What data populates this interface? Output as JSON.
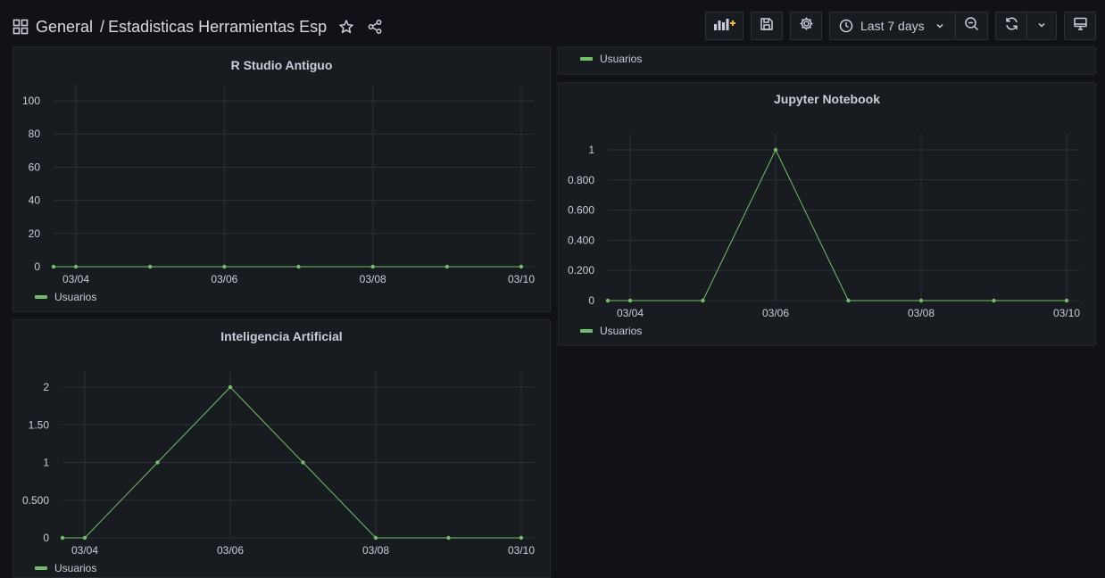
{
  "header": {
    "folder": "General",
    "separator": "/",
    "dashboard_title": "Estadisticas Herramientas Esp",
    "time_range": "Last 7 days"
  },
  "colors": {
    "series": "#73bf69",
    "background": "#111217",
    "panel": "#181b1f",
    "grid": "#2c3038",
    "accent": "#f5b73b"
  },
  "icons": [
    "apps-icon",
    "star-icon",
    "share-icon",
    "add-panel-icon",
    "save-icon",
    "gear-icon",
    "clock-icon",
    "chevron-down-icon",
    "zoom-out-icon",
    "refresh-icon",
    "tv-icon"
  ],
  "top_right_panel": {
    "legend": "Usuarios"
  },
  "chart_data": [
    {
      "type": "line",
      "title": "R Studio Antiguo",
      "x": [
        "03/04",
        "03/05",
        "03/06",
        "03/07",
        "03/08",
        "03/09",
        "03/10"
      ],
      "x_ticks": [
        "03/04",
        "03/06",
        "03/08",
        "03/10"
      ],
      "y_ticks": [
        "0",
        "20",
        "40",
        "60",
        "80",
        "100"
      ],
      "ylim": [
        0,
        100
      ],
      "series": [
        {
          "name": "Usuarios",
          "values": [
            0,
            0,
            0,
            0,
            0,
            0,
            0
          ]
        }
      ],
      "leading_value": 0,
      "legend_placement": "bottom-left",
      "grid": true
    },
    {
      "type": "line",
      "title": "Jupyter Notebook",
      "x": [
        "03/04",
        "03/05",
        "03/06",
        "03/07",
        "03/08",
        "03/09",
        "03/10"
      ],
      "x_ticks": [
        "03/04",
        "03/06",
        "03/08",
        "03/10"
      ],
      "y_ticks": [
        "0",
        "0.200",
        "0.400",
        "0.600",
        "0.800",
        "1"
      ],
      "ylim": [
        0,
        1
      ],
      "series": [
        {
          "name": "Usuarios",
          "values": [
            0,
            0,
            1,
            0,
            0,
            0,
            0
          ]
        }
      ],
      "leading_value": 0,
      "legend_placement": "bottom-left",
      "grid": true
    },
    {
      "type": "line",
      "title": "Inteligencia Artificial",
      "x": [
        "03/04",
        "03/05",
        "03/06",
        "03/07",
        "03/08",
        "03/09",
        "03/10"
      ],
      "x_ticks": [
        "03/04",
        "03/06",
        "03/08",
        "03/10"
      ],
      "y_ticks": [
        "0",
        "0.500",
        "1",
        "1.50",
        "2"
      ],
      "ylim": [
        0,
        2
      ],
      "series": [
        {
          "name": "Usuarios",
          "values": [
            0,
            1,
            2,
            1,
            0,
            0,
            0
          ]
        }
      ],
      "leading_value": 0,
      "legend_placement": "bottom-left",
      "grid": true
    }
  ]
}
